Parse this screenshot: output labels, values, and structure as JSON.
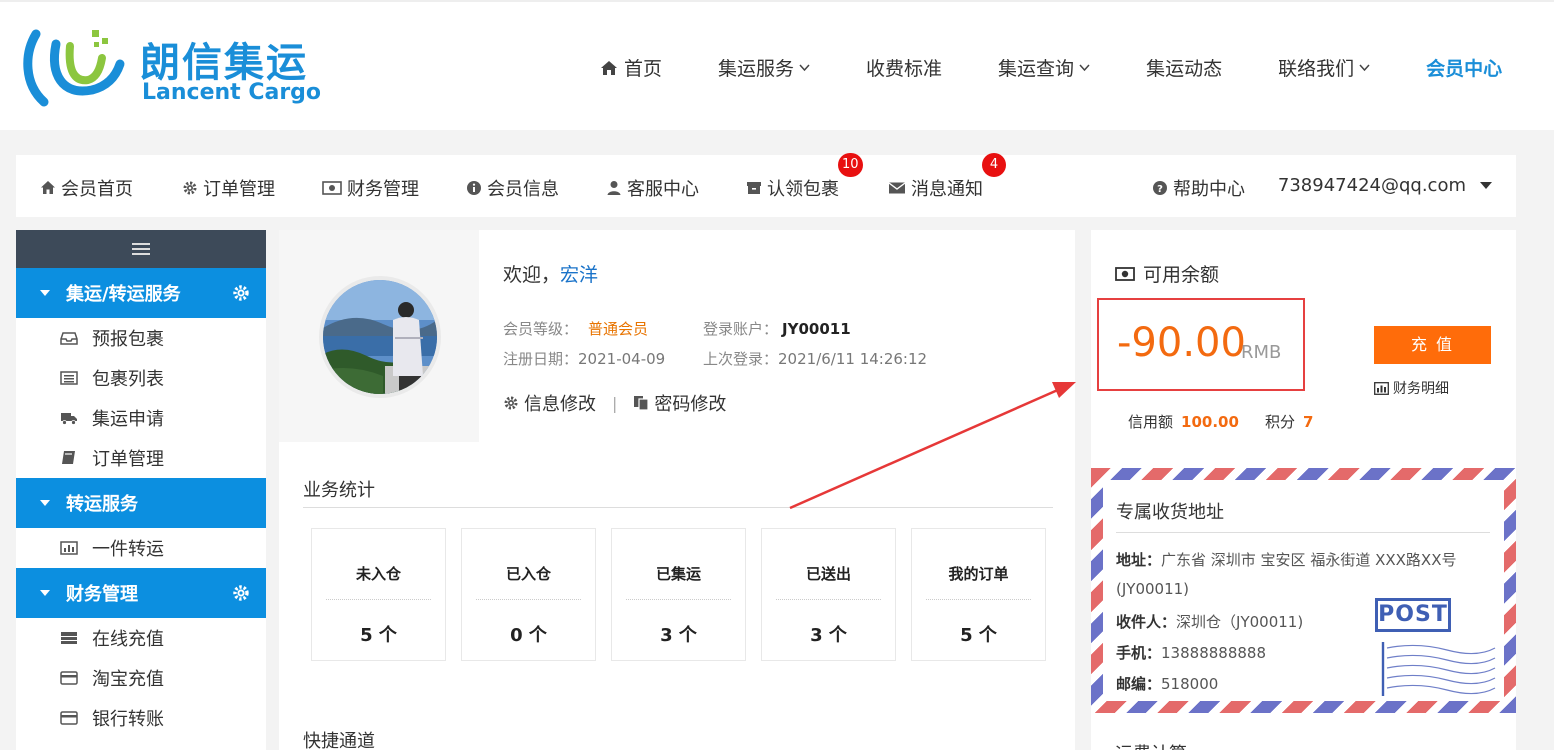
{
  "brand": {
    "name_cn": "朗信集运",
    "name_en": "Lancent Cargo",
    "colors": {
      "primary": "#1a8ed8",
      "accent": "#ff6c0a",
      "highlight": "#e64040"
    }
  },
  "mainnav": {
    "items": [
      {
        "label": "首页",
        "icon": "home-icon"
      },
      {
        "label": "集运服务",
        "dropdown": true
      },
      {
        "label": "收费标准"
      },
      {
        "label": "集运查询",
        "dropdown": true
      },
      {
        "label": "集运动态"
      },
      {
        "label": "联络我们",
        "dropdown": true
      },
      {
        "label": "会员中心",
        "active": true
      }
    ]
  },
  "membar": {
    "items": [
      {
        "label": "会员首页",
        "icon": "home-icon"
      },
      {
        "label": "订单管理",
        "icon": "gear-icon"
      },
      {
        "label": "财务管理",
        "icon": "money-icon"
      },
      {
        "label": "会员信息",
        "icon": "info-icon"
      },
      {
        "label": "客服中心",
        "icon": "user-icon"
      },
      {
        "label": "认领包裹",
        "icon": "box-icon",
        "badge": "10"
      },
      {
        "label": "消息通知",
        "icon": "envelope-icon",
        "badge": "4"
      }
    ],
    "help": "帮助中心",
    "user": "738947424@qq.com"
  },
  "sidebar": {
    "groups": [
      {
        "title": "集运/转运服务",
        "items": [
          "预报包裹",
          "包裹列表",
          "集运申请",
          "订单管理"
        ]
      },
      {
        "title": "转运服务",
        "items": [
          "一件转运"
        ]
      },
      {
        "title": "财务管理",
        "items": [
          "在线充值",
          "淘宝充值",
          "银行转账"
        ]
      }
    ]
  },
  "profile": {
    "welcome_prefix": "欢迎，",
    "name": "宏洋",
    "level_label": "会员等级：",
    "level_value": "普通会员",
    "account_label": "登录账户：",
    "account_value": "JY00011",
    "reg_label": "注册日期：",
    "reg_value": "2021-04-09",
    "last_label": "上次登录：",
    "last_value": "2021/6/11 14:26:12",
    "edit_info": "信息修改",
    "separator": "|",
    "edit_pwd": "密码修改"
  },
  "stats": {
    "title": "业务统计",
    "cards": [
      {
        "label": "未入仓",
        "value": "5 个"
      },
      {
        "label": "已入仓",
        "value": "0 个"
      },
      {
        "label": "已集运",
        "value": "3 个"
      },
      {
        "label": "已送出",
        "value": "3 个"
      },
      {
        "label": "我的订单",
        "value": "5 个"
      }
    ]
  },
  "quick": {
    "title": "快捷通道"
  },
  "balance": {
    "title": "可用余额",
    "amount": "-90.00",
    "unit": "RMB",
    "recharge": "充 值",
    "detail": "财务明细",
    "credit_label": "信用额",
    "credit_value": "100.00",
    "points_label": "积分",
    "points_value": "7"
  },
  "address": {
    "title": "专属收货地址",
    "addr_label": "地址：",
    "addr_value": "广东省 深圳市 宝安区 福永街道 XXX路XX号",
    "addr_code": "(JY00011)",
    "recv_label": "收件人：",
    "recv_value": "深圳仓（JY00011)",
    "phone_label": "手机：",
    "phone_value": "13888888888",
    "zip_label": "邮编：",
    "zip_value": "518000",
    "stamp": "POST"
  },
  "next_section": {
    "title": "运费计算"
  }
}
